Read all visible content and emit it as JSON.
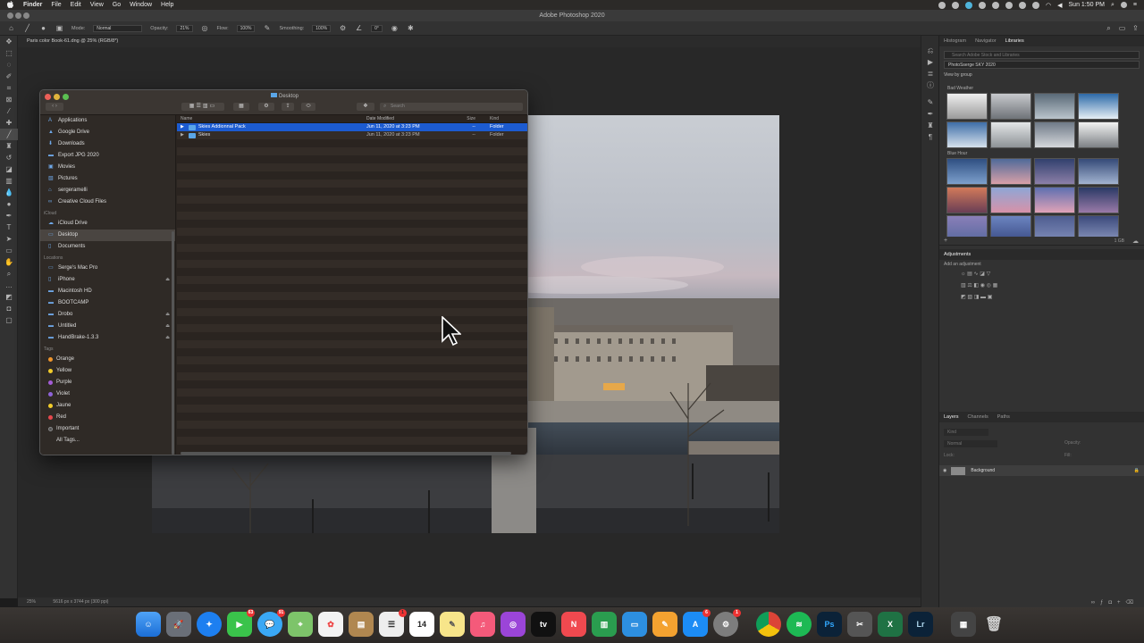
{
  "menubar": {
    "apple": "",
    "items": [
      "Finder",
      "File",
      "Edit",
      "View",
      "Go",
      "Window",
      "Help"
    ],
    "time": "Sun 1:50 PM"
  },
  "ps": {
    "title": "Adobe Photoshop 2020",
    "options": {
      "mode_label": "Mode:",
      "mode_value": "Normal",
      "opacity_label": "Opacity:",
      "opacity_value": "21%",
      "flow_label": "Flow:",
      "flow_value": "100%",
      "smoothing_label": "Smoothing:",
      "smoothing_value": "100%",
      "angle_value": "0°"
    },
    "doc_tab": "Paris color Book-61.dng @ 25% (RGB/8*)",
    "status_zoom": "25%",
    "status_dims": "5616 px x 3744 px (300 ppi)"
  },
  "right_panel": {
    "tabs": [
      "Histogram",
      "Navigator",
      "Libraries"
    ],
    "search_placeholder": "Search Adobe Stock and Libraries",
    "library_name": "PhotoSserge SKY 2020",
    "view_by": "View by group",
    "group1": "Bad Weather",
    "group2": "Blue Hour",
    "size_label": "1 GB",
    "adjustments_title": "Adjustments",
    "add_adjustment": "Add an adjustment",
    "layer_tabs": [
      "Layers",
      "Channels",
      "Paths"
    ],
    "layer_kind": "Kind",
    "blend": "Normal",
    "opacity": "Opacity:",
    "lock": "Lock:",
    "fill": "Fill:",
    "layer_name": "Background"
  },
  "finder": {
    "title": "Desktop",
    "search_placeholder": "Search",
    "favorites": [
      "Applications",
      "Google Drive",
      "Downloads",
      "Export JPG 2020",
      "Movies",
      "Pictures",
      "sergeramelli",
      "Creative Cloud Files"
    ],
    "icloud_head": "iCloud",
    "icloud": [
      "iCloud Drive",
      "Desktop",
      "Documents"
    ],
    "locations_head": "Locations",
    "locations": [
      "Serge's Mac Pro",
      "iPhone",
      "Macintosh HD",
      "BOOTCAMP",
      "Drobo",
      "Untitled",
      "HandBrake-1.3.3"
    ],
    "tags_head": "Tags",
    "tags": [
      {
        "name": "Orange",
        "color": "#f0962c"
      },
      {
        "name": "Yellow",
        "color": "#f2cc2b"
      },
      {
        "name": "Purple",
        "color": "#a45cd6"
      },
      {
        "name": "Violet",
        "color": "#8f63d9"
      },
      {
        "name": "Jaune",
        "color": "#f2cc2b"
      },
      {
        "name": "Red",
        "color": "#e5484d"
      },
      {
        "name": "Important",
        "color": "#555555"
      },
      {
        "name": "All Tags...",
        "color": ""
      }
    ],
    "columns": {
      "name": "Name",
      "date": "Date Modified",
      "size": "Size",
      "kind": "Kind"
    },
    "rows": [
      {
        "name": "Skies Addionnal Pack",
        "date": "Jun 11, 2020 at 3:23 PM",
        "size": "--",
        "kind": "Folder"
      },
      {
        "name": "Skies",
        "date": "Jun 11, 2020 at 3:23 PM",
        "size": "--",
        "kind": "Folder"
      }
    ]
  },
  "dock": {
    "badges": {
      "facetime": "63",
      "messages": "91",
      "calendar_day": "14",
      "appstore": "6"
    }
  },
  "colors": {
    "selection": "#1c5bd0",
    "accent": "#5aa6e8"
  }
}
